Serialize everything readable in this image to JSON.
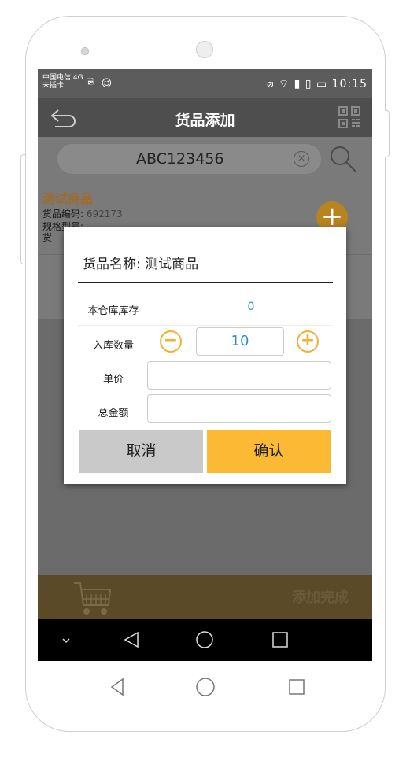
{
  "status_bar": {
    "carrier_line1": "中国电信 4G",
    "carrier_line2": "未插卡",
    "time": "10:15"
  },
  "header": {
    "title": "货品添加"
  },
  "search": {
    "value": "ABC123456"
  },
  "product_card": {
    "name": "测试商品",
    "code_label": "货品编码:",
    "code_value": "692173",
    "spec_label": "规格型号:",
    "goods_label": "货"
  },
  "dialog": {
    "title": "货品名称: 测试商品",
    "stock_label": "本仓库库存",
    "stock_value": "0",
    "qty_label": "入库数量",
    "qty_value": "10",
    "price_label": "单价",
    "total_label": "总金额",
    "cancel_label": "取消",
    "confirm_label": "确认"
  },
  "footer": {
    "done_label": "添加完成"
  },
  "colors": {
    "accent": "#fbb934",
    "value_blue": "#2b8ad8",
    "product_brown": "#a06b2b"
  }
}
